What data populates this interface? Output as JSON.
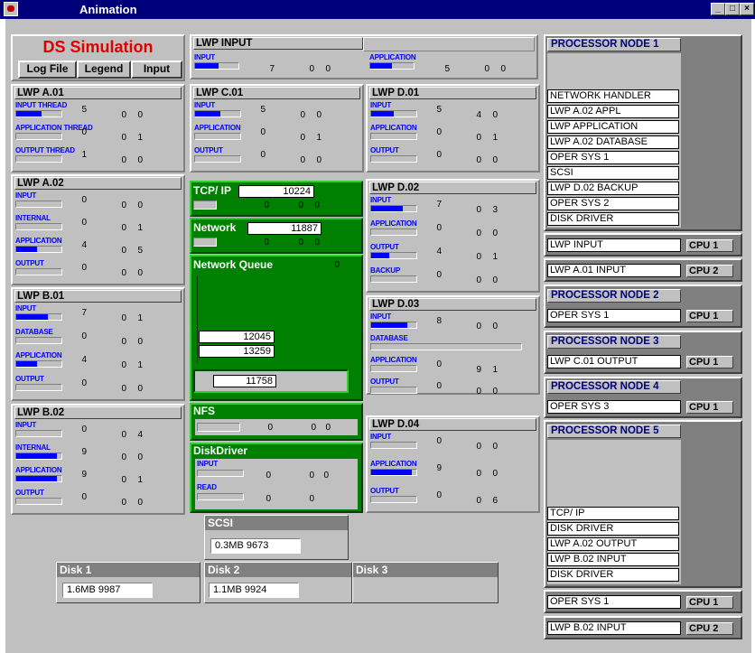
{
  "window": {
    "title": "Animation",
    "min": "_",
    "max": "□",
    "close": "×"
  },
  "header": {
    "title": "DS Simulation",
    "logfile": "Log File",
    "legend": "Legend",
    "input": "Input"
  },
  "lwp_input": {
    "title": "LWP INPUT",
    "input_label": "INPUT",
    "input_values": [
      "7",
      "0",
      "0"
    ],
    "input_fill": 0.55,
    "app_label": "APPLICATION",
    "app_values": [
      "5",
      "0",
      "0"
    ],
    "app_fill": 0.5
  },
  "lwp_a01": {
    "title": "LWP A.01",
    "rows": [
      {
        "label": "INPUT THREAD",
        "fill": 0.55,
        "values": [
          "5",
          "0",
          "0"
        ]
      },
      {
        "label": "APPLICATION THREAD",
        "fill": 0,
        "values": [
          "0",
          "0",
          "1"
        ]
      },
      {
        "label": "OUTPUT THREAD",
        "fill": 0,
        "values": [
          "1",
          "0",
          "0"
        ]
      }
    ]
  },
  "lwp_a02": {
    "title": "LWP A.02",
    "rows": [
      {
        "label": "INPUT",
        "fill": 0,
        "values": [
          "0",
          "0",
          "0"
        ]
      },
      {
        "label": "INTERNAL",
        "fill": 0,
        "values": [
          "0",
          "0",
          "1"
        ]
      },
      {
        "label": "APPLICATION",
        "fill": 0.45,
        "values": [
          "4",
          "0",
          "5"
        ]
      },
      {
        "label": "OUTPUT",
        "fill": 0,
        "values": [
          "0",
          "0",
          "0"
        ]
      }
    ]
  },
  "lwp_b01": {
    "title": "LWP B.01",
    "rows": [
      {
        "label": "INPUT",
        "fill": 0.7,
        "values": [
          "7",
          "0",
          "1"
        ]
      },
      {
        "label": "DATABASE",
        "fill": 0,
        "values": [
          "0",
          "0",
          "0"
        ]
      },
      {
        "label": "APPLICATION",
        "fill": 0.45,
        "values": [
          "4",
          "0",
          "1"
        ]
      },
      {
        "label": "OUTPUT",
        "fill": 0,
        "values": [
          "0",
          "0",
          "0"
        ]
      }
    ]
  },
  "lwp_b02": {
    "title": "LWP B.02",
    "rows": [
      {
        "label": "INPUT",
        "fill": 0,
        "values": [
          "0",
          "0",
          "4"
        ]
      },
      {
        "label": "INTERNAL",
        "fill": 0.9,
        "values": [
          "9",
          "0",
          "0"
        ]
      },
      {
        "label": "APPLICATION",
        "fill": 0.9,
        "values": [
          "9",
          "0",
          "1"
        ]
      },
      {
        "label": "OUTPUT",
        "fill": 0,
        "values": [
          "0",
          "0",
          "0"
        ]
      }
    ]
  },
  "lwp_c01": {
    "title": "LWP C.01",
    "rows": [
      {
        "label": "INPUT",
        "fill": 0.55,
        "values": [
          "5",
          "0",
          "0"
        ]
      },
      {
        "label": "APPLICATION",
        "fill": 0,
        "values": [
          "0",
          "0",
          "1"
        ]
      },
      {
        "label": "OUTPUT",
        "fill": 0,
        "values": [
          "0",
          "0",
          "0"
        ]
      }
    ]
  },
  "lwp_d01": {
    "title": "LWP D.01",
    "rows": [
      {
        "label": "INPUT",
        "fill": 0.5,
        "values": [
          "5",
          "4",
          "0"
        ]
      },
      {
        "label": "APPLICATION",
        "fill": 0,
        "values": [
          "0",
          "0",
          "1"
        ]
      },
      {
        "label": "OUTPUT",
        "fill": 0,
        "values": [
          "0",
          "0",
          "0"
        ]
      }
    ]
  },
  "lwp_d02": {
    "title": "LWP D.02",
    "rows": [
      {
        "label": "INPUT",
        "fill": 0.7,
        "values": [
          "7",
          "0",
          "3"
        ]
      },
      {
        "label": "APPLICATION",
        "fill": 0,
        "values": [
          "0",
          "0",
          "0"
        ]
      },
      {
        "label": "OUTPUT",
        "fill": 0.4,
        "values": [
          "4",
          "0",
          "1"
        ]
      },
      {
        "label": "BACKUP",
        "fill": 0,
        "values": [
          "0",
          "0",
          "0"
        ]
      }
    ]
  },
  "lwp_d03": {
    "title": "LWP D.03",
    "rows": [
      {
        "label": "INPUT",
        "fill": 0.8,
        "values": [
          "8",
          "0",
          "0"
        ]
      },
      {
        "label": "DATABASE",
        "fill": 0,
        "values": [
          "",
          "",
          ""
        ]
      },
      {
        "label": "APPLICATION",
        "fill": 0,
        "values": [
          "0",
          "9",
          "1"
        ]
      },
      {
        "label": "OUTPUT",
        "fill": 0,
        "values": [
          "0",
          "0",
          "0"
        ]
      }
    ]
  },
  "lwp_d04": {
    "title": "LWP D.04",
    "rows": [
      {
        "label": "INPUT",
        "fill": 0,
        "values": [
          "0",
          "0",
          "0"
        ]
      },
      {
        "label": "APPLICATION",
        "fill": 0.9,
        "values": [
          "9",
          "0",
          "0"
        ]
      },
      {
        "label": "OUTPUT",
        "fill": 0,
        "values": [
          "0",
          "0",
          "6"
        ]
      }
    ]
  },
  "tcpip": {
    "title": "TCP/ IP",
    "value": "10224",
    "row_values": [
      "0",
      "0",
      "0"
    ]
  },
  "network": {
    "title": "Network",
    "value": "11887",
    "row_values": [
      "0",
      "0",
      "0"
    ]
  },
  "netqueue": {
    "title": "Network Queue",
    "count": "0",
    "items": [
      "12045",
      "13259"
    ],
    "extra": "11758"
  },
  "nfs": {
    "title": "NFS",
    "values": [
      "0",
      "0",
      "0"
    ]
  },
  "diskdriver": {
    "title": "DiskDriver",
    "rows": [
      {
        "label": "INPUT",
        "values": [
          "0",
          "0",
          "0"
        ]
      },
      {
        "label": "READ",
        "values": [
          "0",
          "0"
        ]
      }
    ]
  },
  "scsi": {
    "title": "SCSI",
    "value": "0.3MB 9673"
  },
  "disks": [
    {
      "title": "Disk 1",
      "value": "1.6MB 9987"
    },
    {
      "title": "Disk 2",
      "value": "1.1MB 9924"
    },
    {
      "title": "Disk 3",
      "value": ""
    }
  ],
  "processors": {
    "node1": {
      "title": "PROCESSOR NODE 1",
      "tasks": [
        "NETWORK HANDLER",
        "LWP A.02 APPL",
        "LWP APPLICATION",
        "LWP A.02 DATABASE",
        "OPER SYS 1",
        "SCSI",
        "LWP D.02 BACKUP",
        "OPER SYS 2",
        "DISK DRIVER"
      ]
    },
    "cpu_rows": [
      {
        "task": "LWP INPUT",
        "cpu": "CPU 1"
      },
      {
        "task": "LWP A.01 INPUT",
        "cpu": "CPU 2"
      }
    ],
    "node2": {
      "title": "PROCESSOR NODE 2",
      "task": "OPER SYS 1",
      "cpu": "CPU 1"
    },
    "node3": {
      "title": "PROCESSOR NODE 3",
      "task": "LWP C.01 OUTPUT",
      "cpu": "CPU 1"
    },
    "node4": {
      "title": "PROCESSOR NODE 4",
      "task": "OPER SYS 3",
      "cpu": "CPU 1"
    },
    "node5": {
      "title": "PROCESSOR NODE 5",
      "tasks": [
        "TCP/ IP",
        "DISK DRIVER",
        "LWP A.02 OUTPUT",
        "LWP B.02 INPUT",
        "DISK DRIVER"
      ]
    },
    "cpu_rows2": [
      {
        "task": "OPER SYS 1",
        "cpu": "CPU 1"
      },
      {
        "task": "LWP B.02 INPUT",
        "cpu": "CPU 2"
      }
    ]
  }
}
